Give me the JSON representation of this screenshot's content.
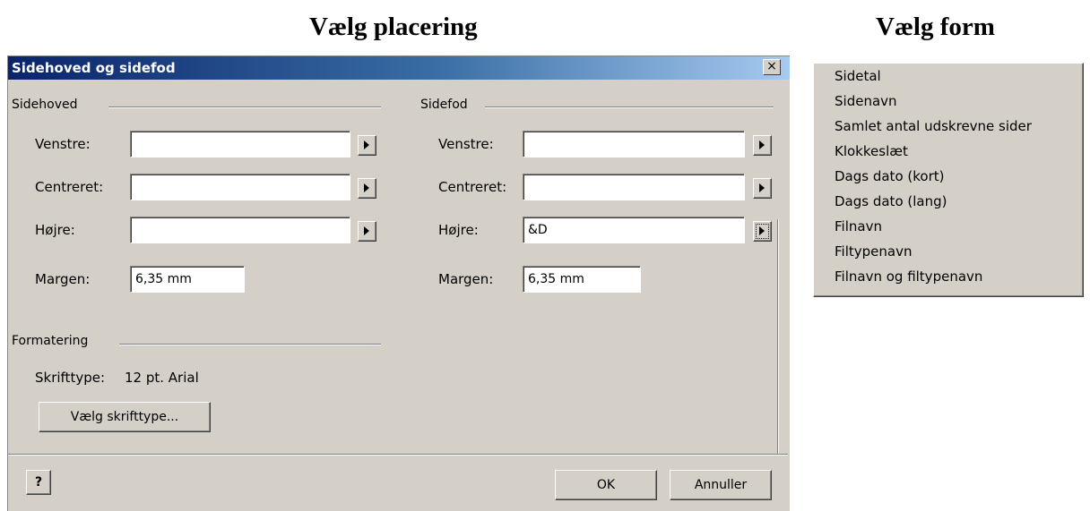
{
  "headings": {
    "left": "Vælg placering",
    "right": "Vælg form"
  },
  "dialog": {
    "title": "Sidehoved og sidefod",
    "close_glyph": "×",
    "header_group": {
      "label": "Sidehoved",
      "left_label": "Venstre:",
      "left_value": "",
      "center_label": "Centreret:",
      "center_value": "",
      "right_label": "Højre:",
      "right_value": "",
      "margin_label": "Margen:",
      "margin_value": "6,35 mm"
    },
    "footer_group": {
      "label": "Sidefod",
      "left_label": "Venstre:",
      "left_value": "",
      "center_label": "Centreret:",
      "center_value": "",
      "right_label": "Højre:",
      "right_value": "&D",
      "margin_label": "Margen:",
      "margin_value": "6,35 mm"
    },
    "format_group": {
      "label": "Formatering",
      "font_label": "Skrifttype:",
      "font_value": "12 pt. Arial",
      "choose_font_button": "Vælg skrifttype..."
    },
    "help_glyph": "?",
    "ok_button": "OK",
    "cancel_button": "Annuller"
  },
  "menu": {
    "items": [
      "Sidetal",
      "Sidenavn",
      "Samlet antal udskrevne sider",
      "Klokkeslæt",
      "Dags dato (kort)",
      "Dags dato (lang)",
      "Filnavn",
      "Filtypenavn",
      "Filnavn og filtypenavn"
    ]
  }
}
